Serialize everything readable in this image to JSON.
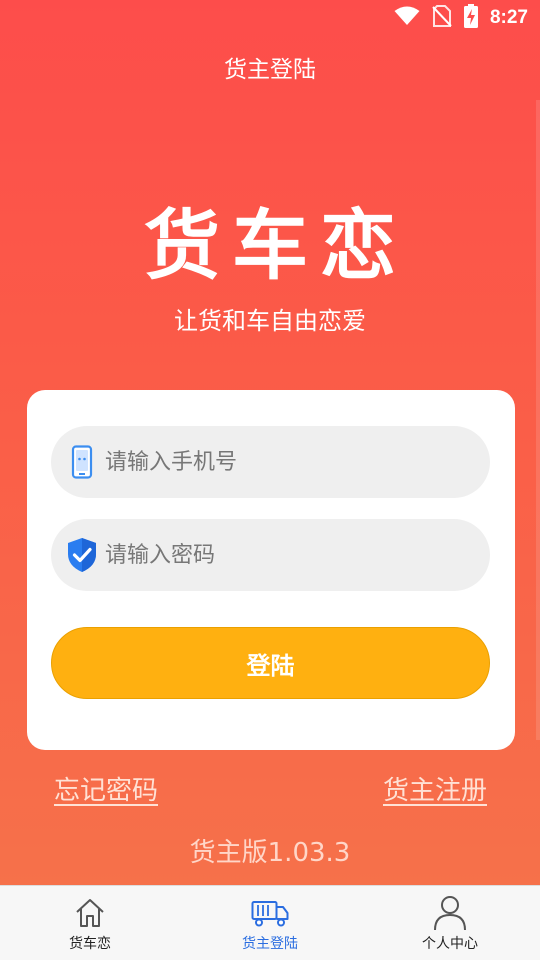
{
  "status_bar": {
    "time": "8:27",
    "icons": [
      "wifi-icon",
      "no-sim-icon",
      "battery-charging-icon"
    ]
  },
  "app_bar": {
    "title": "货主登陆"
  },
  "brand": {
    "name": "货车恋",
    "slogan": "让货和车自由恋爱"
  },
  "login_form": {
    "phone_placeholder": "请输入手机号",
    "phone_value": "",
    "phone_icon": "phone-icon",
    "password_placeholder": "请输入密码",
    "password_value": "",
    "password_icon": "shield-check-icon",
    "submit_label": "登陆"
  },
  "links": {
    "forgot_password": "忘记密码",
    "register": "货主注册"
  },
  "version": "货主版1.03.3",
  "tab_bar": {
    "items": [
      {
        "label": "货车恋",
        "icon": "home-icon",
        "active": false
      },
      {
        "label": "货主登陆",
        "icon": "truck-icon",
        "active": true
      },
      {
        "label": "个人中心",
        "icon": "person-icon",
        "active": false
      }
    ]
  },
  "colors": {
    "header_red": "#fd4d4b",
    "gradient_bottom": "#f6714a",
    "button_orange": "#ffb010",
    "active_tab_blue": "#2a6de0"
  }
}
